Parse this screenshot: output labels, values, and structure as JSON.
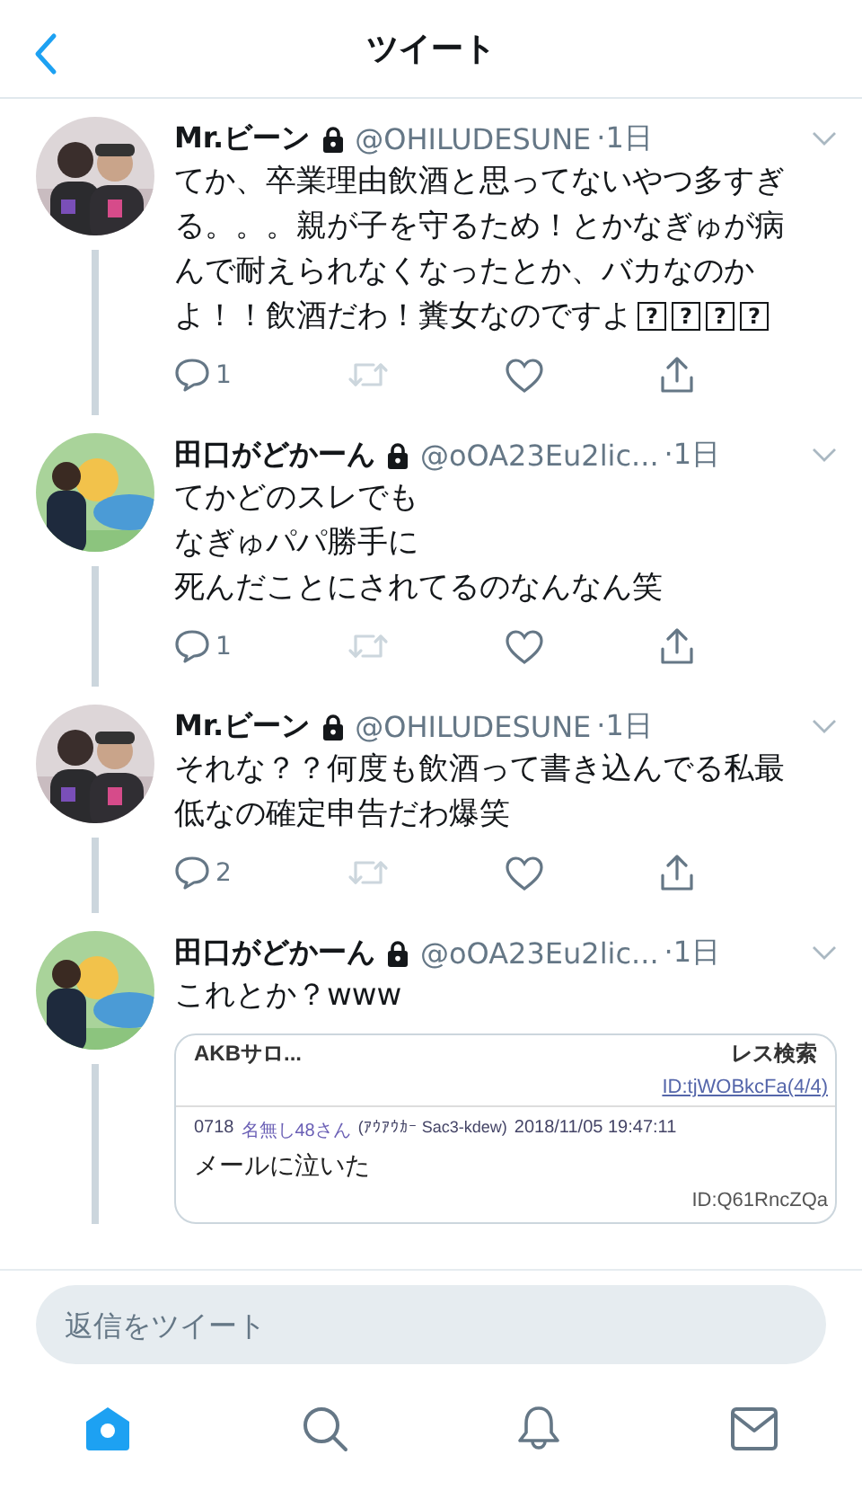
{
  "header": {
    "title": "ツイート"
  },
  "tweets": [
    {
      "name": "Mr.ビーン",
      "protected": true,
      "handle": "@OHILUDESUNE",
      "time": "·1日",
      "text": "てか、卒業理由飲酒と思ってないやつ多すぎる。。。親が子を守るため！とかなぎゅが病んで耐えられなくなったとか、バカなのかよ！！飲酒だわ！糞女なのですよ",
      "missing_glyphs": [
        "?",
        "?",
        "?",
        "?"
      ],
      "actions": {
        "replies": "1",
        "retweet_disabled": true
      },
      "thread_line": true
    },
    {
      "name": "田口がどかーん",
      "protected": true,
      "handle": "@oOA23Eu2lic...",
      "time": "·1日",
      "lines": [
        "てかどのスレでも",
        "なぎゅパパ勝手に",
        "死んだことにされてるのなんなん笑"
      ],
      "actions": {
        "replies": "1",
        "retweet_disabled": true
      },
      "thread_line": true
    },
    {
      "name": "Mr.ビーン",
      "protected": true,
      "handle": "@OHILUDESUNE",
      "time": "·1日",
      "text": "それな？？何度も飲酒って書き込んでる私最低なの確定申告だわ爆笑",
      "actions": {
        "replies": "2",
        "retweet_disabled": true
      },
      "thread_line": true
    },
    {
      "name": "田口がどかーん",
      "protected": true,
      "handle": "@oOA23Eu2lic...",
      "time": "·1日",
      "text": "これとか？www",
      "thread_line": true,
      "embed": {
        "board": "AKBサロ...",
        "search": "レス検索",
        "prev_id": "ID:tjWOBkcFa(4/4)",
        "post": {
          "number": "0718",
          "author": "名無し48さん",
          "meta": "(ｱｳｱｳｶｰ Sac3-kdew)",
          "date": "2018/11/05 19:47:11",
          "body": "メールに泣いた",
          "id": "ID:Q61RncZQa"
        }
      }
    }
  ],
  "reply_box": {
    "placeholder": "返信をツイート"
  },
  "tabs": [
    {
      "kind": "home",
      "selected": true
    },
    {
      "kind": "search",
      "selected": false
    },
    {
      "kind": "notifications",
      "selected": false
    },
    {
      "kind": "messages",
      "selected": false
    }
  ]
}
